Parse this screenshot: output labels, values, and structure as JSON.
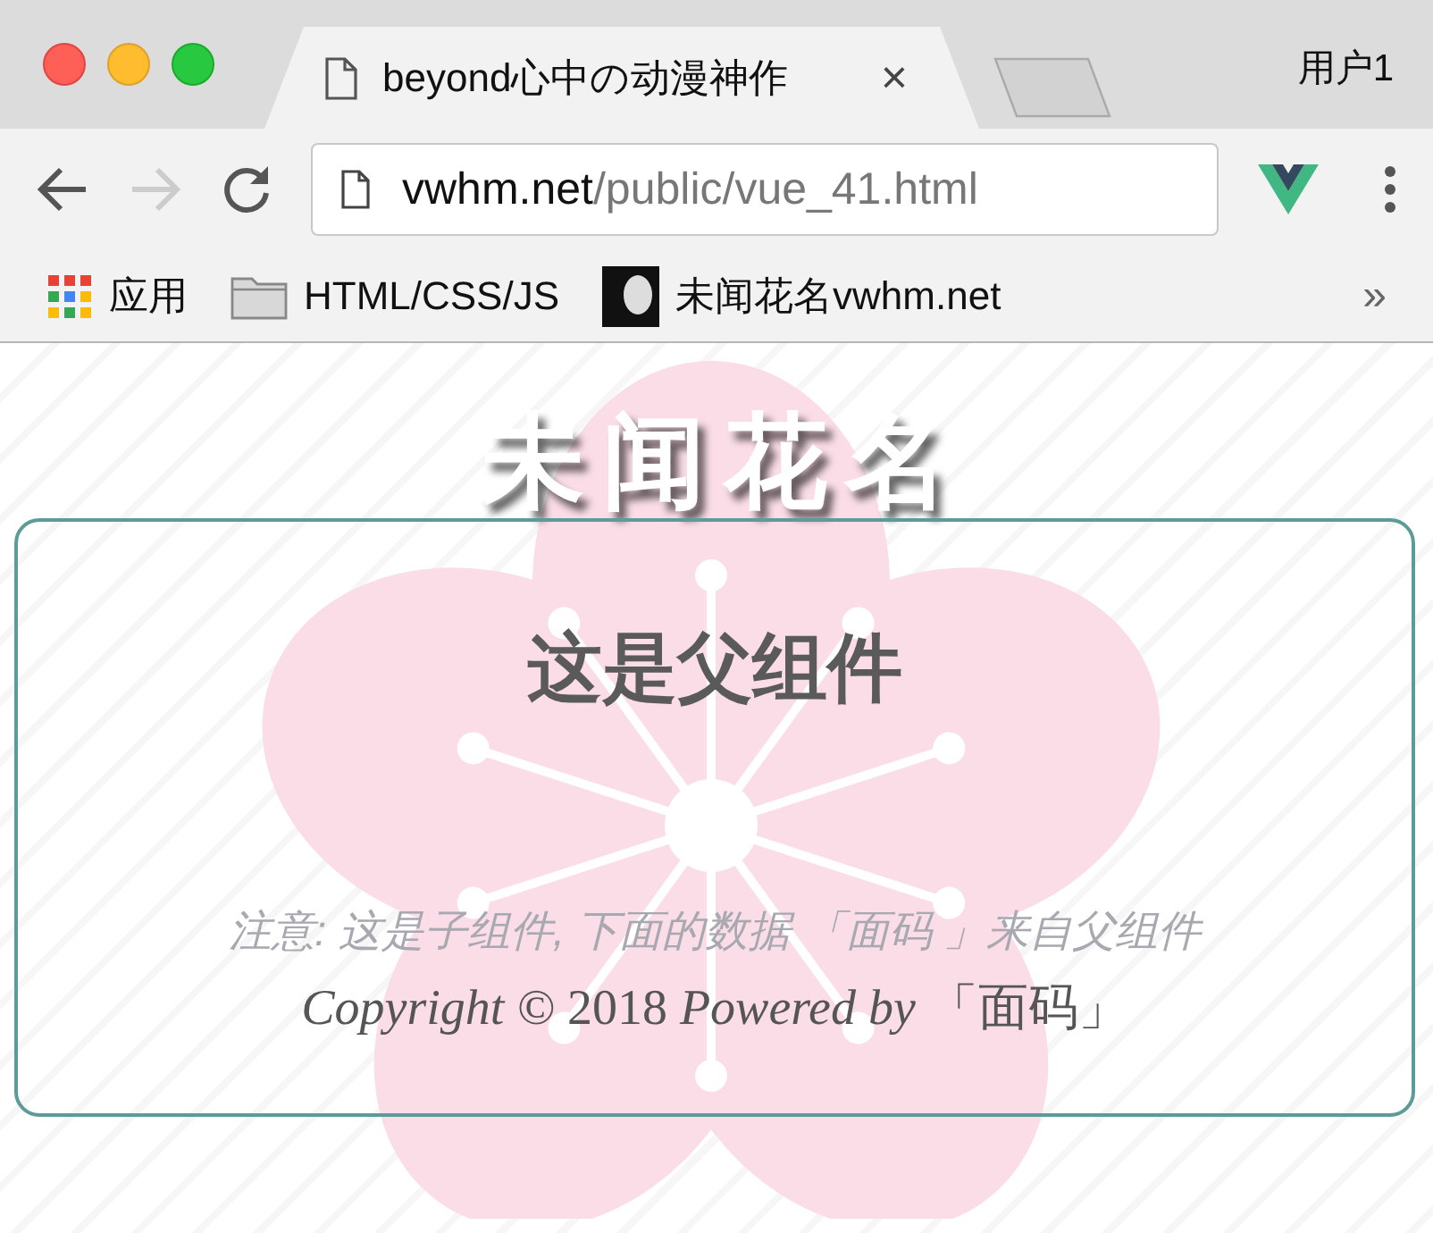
{
  "tabs": [
    {
      "label": "beyond心中の动漫神作",
      "selected": true,
      "close": "×"
    }
  ],
  "profile": "用户1",
  "address": {
    "domain": "vwhm.net",
    "path": "/public/vue_41.html"
  },
  "bookmarks": [
    {
      "label": "应用",
      "kind": "apps"
    },
    {
      "label": "HTML/CSS/JS",
      "kind": "folder"
    },
    {
      "label": "未闻花名vwhm.net",
      "kind": "site"
    }
  ],
  "bookmarks_overflow": "»",
  "page": {
    "heading": "未闻花名",
    "card": {
      "title": "这是父组件",
      "note": "注意: 这是子组件, 下面的数据 「面码 」来自父组件",
      "footer": "*Copyright ©* 2018 *Powered by* 「面码」"
    }
  }
}
